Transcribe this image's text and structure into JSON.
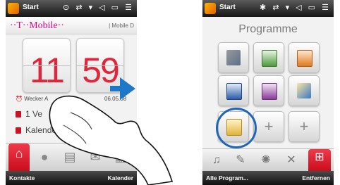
{
  "left_screen": {
    "status": {
      "start_label": "Start",
      "icons": "⊙ ⇄ ▾ ◁ ▭ ☰"
    },
    "carrier": {
      "logo": "··T··Mobile··",
      "right_text": "| Mobile D"
    },
    "clock": {
      "hours": "11",
      "minutes": "59"
    },
    "alarm": {
      "label": "Wecker A",
      "date": "06.05.08"
    },
    "rows": [
      {
        "label": "1 Ve"
      },
      {
        "label": "Kalende"
      }
    ],
    "tabs": [
      "home-icon",
      "contacts-icon",
      "messages-icon",
      "mail-icon",
      "calendar-icon"
    ],
    "softkeys": {
      "left": "Kontakte",
      "right": "Kalender"
    },
    "accent_color": "#e1253a"
  },
  "right_screen": {
    "status": {
      "start_label": "Start",
      "icons": "✱ ⇄ ▾ ◁ ▭ ☰"
    },
    "title": "Programme",
    "plus": "+",
    "apps": [
      {
        "icon": "tools-icon"
      },
      {
        "icon": "excel-icon"
      },
      {
        "icon": "powerpoint-icon"
      },
      {
        "icon": "word-icon"
      },
      {
        "icon": "onenote-icon"
      },
      {
        "icon": "explorer-icon"
      },
      {
        "icon": "search-file-icon"
      },
      {
        "icon": "add-icon"
      },
      {
        "icon": "add-icon"
      }
    ],
    "tabs": [
      "music-icon",
      "pen-icon",
      "settings-icon",
      "tools-icon",
      "programs-icon"
    ],
    "softkeys": {
      "left": "Alle Program...",
      "right": "Entfernen"
    },
    "highlight_color": "#1f66b9"
  }
}
